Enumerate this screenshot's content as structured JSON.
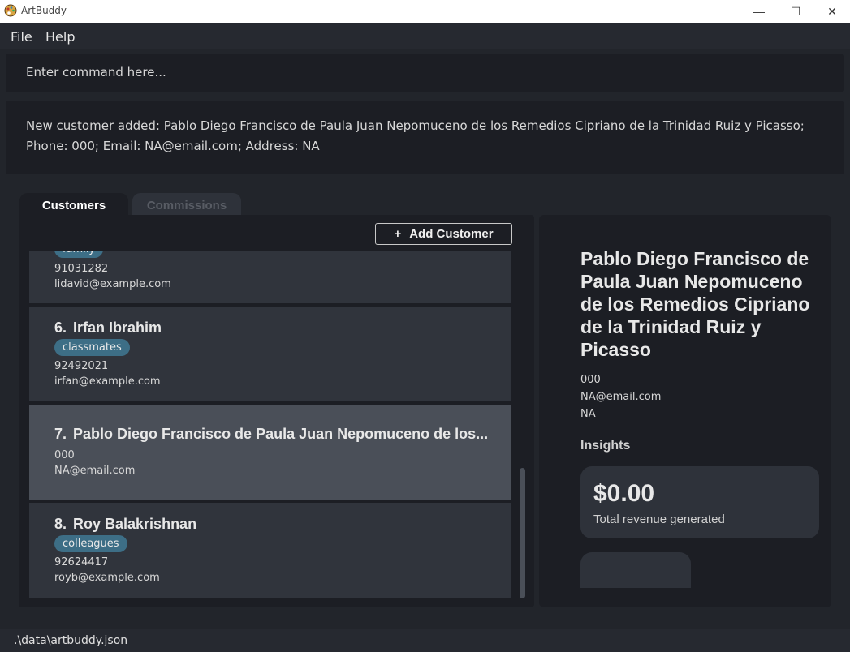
{
  "window": {
    "title": "ArtBuddy",
    "minimize": "—",
    "maximize": "☐",
    "close": "✕"
  },
  "menu": {
    "file": "File",
    "help": "Help"
  },
  "command": {
    "placeholder": "Enter command here..."
  },
  "result": {
    "text": "New customer added: Pablo Diego Francisco de Paula Juan Nepomuceno de los Remedios Cipriano de la Trinidad Ruiz y Picasso; Phone: 000; Email: NA@email.com; Address: NA"
  },
  "tabs": {
    "customers": "Customers",
    "commissions": "Commissions"
  },
  "list": {
    "add_button": "Add Customer",
    "add_icon": "+",
    "cards": [
      {
        "tag": "family",
        "phone": "91031282",
        "email": "lidavid@example.com"
      },
      {
        "index": "6.",
        "name": "Irfan Ibrahim",
        "tag": "classmates",
        "phone": "92492021",
        "email": "irfan@example.com"
      },
      {
        "index": "7.",
        "name": "Pablo Diego Francisco de Paula Juan Nepomuceno de los...",
        "phone": "000",
        "email": "NA@email.com"
      },
      {
        "index": "8.",
        "name": "Roy Balakrishnan",
        "tag": "colleagues",
        "phone": "92624417",
        "email": "royb@example.com"
      }
    ]
  },
  "detail": {
    "name": "Pablo Diego Francisco de Paula Juan Nepomuceno de los Remedios Cipriano de la Trinidad Ruiz y Picasso",
    "phone": "000",
    "email": "NA@email.com",
    "address": "NA",
    "insights_title": "Insights",
    "revenue_value": "$0.00",
    "revenue_label": "Total revenue generated"
  },
  "status": {
    "path": ".\\data\\artbuddy.json"
  },
  "colors": {
    "background": "#22252b",
    "panel": "#1c1e24",
    "card": "#30343c",
    "card_selected": "#4a4f58",
    "tag": "#3d6e86"
  }
}
